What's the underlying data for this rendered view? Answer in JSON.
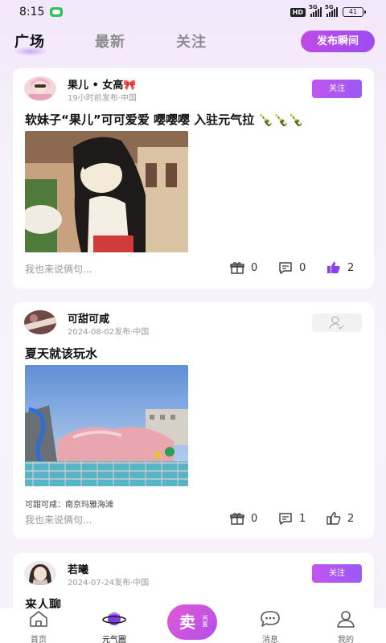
{
  "status_bar": {
    "time": "8:15",
    "hd": "HD",
    "net1": "5G",
    "net2": "5G",
    "battery": "41"
  },
  "header": {
    "tabs": [
      {
        "label": "广场"
      },
      {
        "label": "最新"
      },
      {
        "label": "关注"
      }
    ],
    "publish_label": "发布瞬间"
  },
  "posts": [
    {
      "user": "果儿 • 女高🎀",
      "meta": "19小时前发布·中国",
      "follow_label": "关注",
      "title": "软妹子“果儿”可可爱爱 嘤嘤嘤 入驻元气拉 🍾🍾🍾",
      "comment_hint": "我也来说俩句...",
      "gifts": "0",
      "comments": "0",
      "likes": "2"
    },
    {
      "user": "可甜可咸",
      "meta": "2024-08-02发布·中国",
      "title": "夏天就该玩水",
      "location": "可甜可咸：南京玛雅海滩",
      "comment_hint": "我也来说俩句...",
      "gifts": "0",
      "comments": "1",
      "likes": "2"
    },
    {
      "user": "若曦",
      "meta": "2024-07-24发布·中国",
      "follow_label": "关注",
      "title": "来人聊"
    }
  ],
  "bottom_nav": {
    "items": [
      {
        "label": "首页"
      },
      {
        "label": "元气圈"
      },
      {
        "label": "消息"
      },
      {
        "label": "我的"
      }
    ],
    "sell_big": "卖",
    "sell_small": "闲置"
  },
  "colors": {
    "accent": "#a44ef0",
    "like_active": "#8a3ff0"
  }
}
